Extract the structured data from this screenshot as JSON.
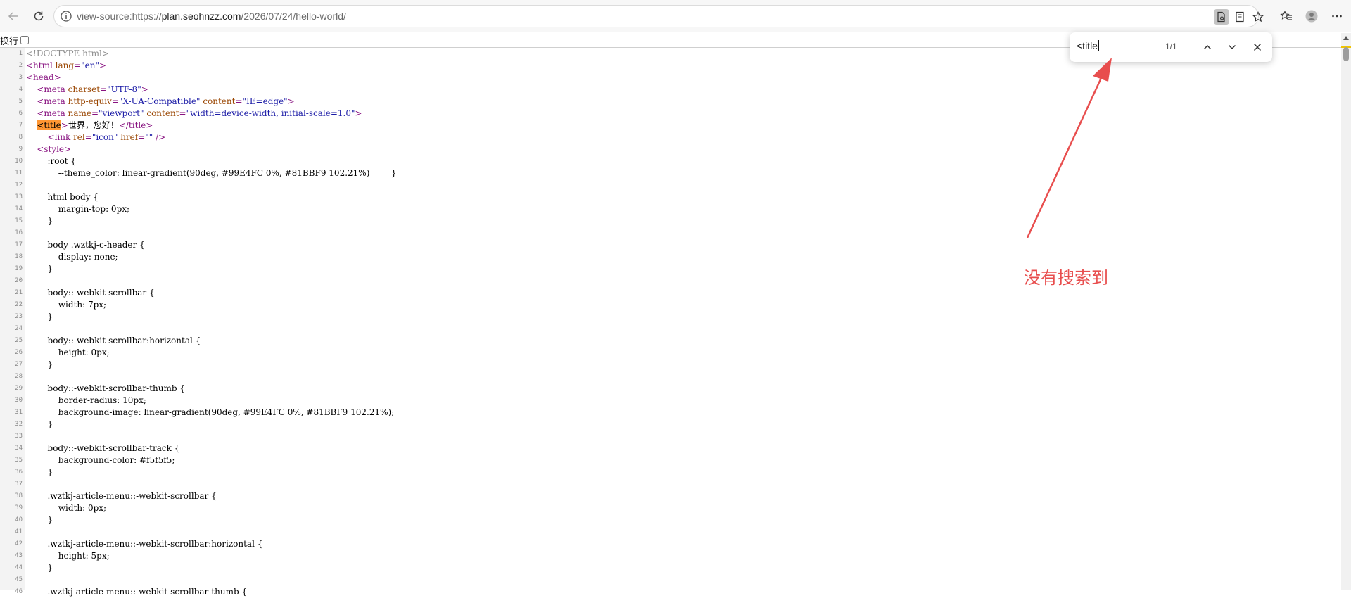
{
  "browser": {
    "url_prefix": "view-source:https://",
    "url_host": "plan.seohnzz.com",
    "url_path": "/2026/07/24/hello-world/"
  },
  "source_view": {
    "wrap_label": "换行",
    "wrap_checked": false,
    "lines": [
      "<!DOCTYPE html>",
      "<html lang=\"en\">",
      "<head>",
      "    <meta charset=\"UTF-8\">",
      "    <meta http-equiv=\"X-UA-Compatible\" content=\"IE=edge\">",
      "    <meta name=\"viewport\" content=\"width=device-width, initial-scale=1.0\">",
      "    <title>世界，您好！</title>",
      "        <link rel=\"icon\" href=\"\" />",
      "    <style>",
      "        :root {",
      "            --theme_color: linear-gradient(90deg, #99E4FC 0%, #81BBF9 102.21%)        }",
      "",
      "        html body {",
      "            margin-top: 0px;",
      "        }",
      "",
      "        body .wztkj-c-header {",
      "            display: none;",
      "        }",
      "",
      "        body::-webkit-scrollbar {",
      "            width: 7px;",
      "        }",
      "",
      "        body::-webkit-scrollbar:horizontal {",
      "            height: 0px;",
      "        }",
      "",
      "        body::-webkit-scrollbar-thumb {",
      "            border-radius: 10px;",
      "            background-image: linear-gradient(90deg, #99E4FC 0%, #81BBF9 102.21%);",
      "        }",
      "",
      "        body::-webkit-scrollbar-track {",
      "            background-color: #f5f5f5;",
      "        }",
      "",
      "        .wztkj-article-menu::-webkit-scrollbar {",
      "            width: 0px;",
      "        }",
      "",
      "        .wztkj-article-menu::-webkit-scrollbar:horizontal {",
      "            height: 5px;",
      "        }",
      "",
      "        .wztkj-article-menu::-webkit-scrollbar-thumb {"
    ]
  },
  "find_bar": {
    "query": "<title",
    "count": "1/1"
  },
  "annotation": {
    "text": "没有搜索到",
    "color": "#e84e4e"
  }
}
